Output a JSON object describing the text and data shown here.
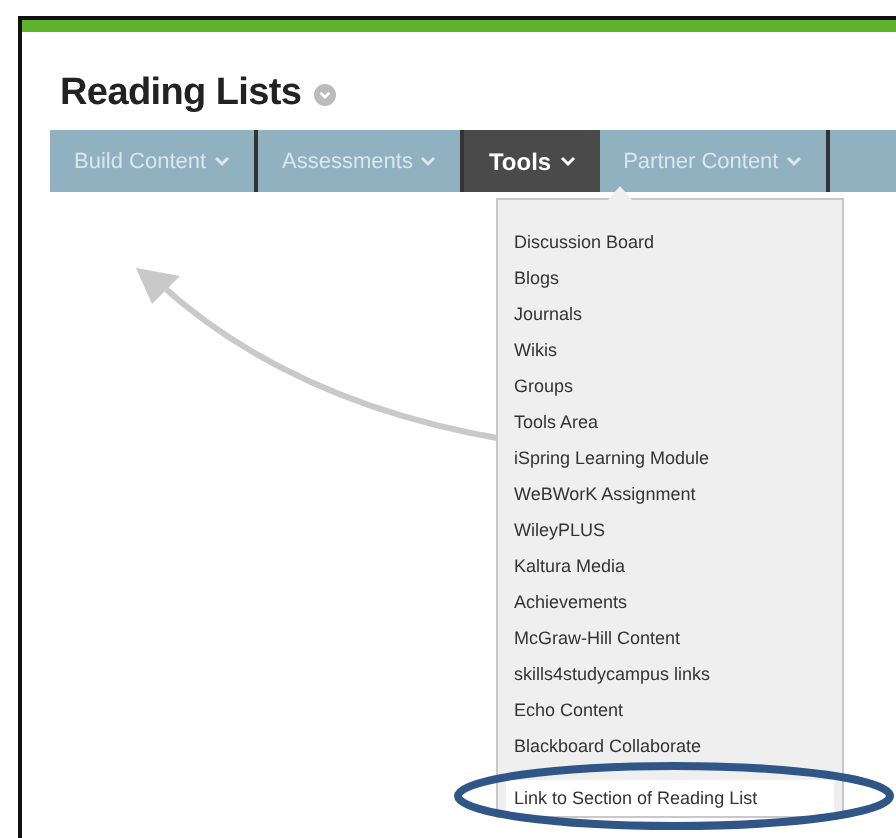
{
  "page": {
    "title": "Reading Lists"
  },
  "tabs": [
    {
      "label": "Build Content",
      "selected": false
    },
    {
      "label": "Assessments",
      "selected": false
    },
    {
      "label": "Tools",
      "selected": true
    },
    {
      "label": "Partner Content",
      "selected": false
    }
  ],
  "dropdown": {
    "items": [
      {
        "label": "Discussion Board",
        "selected": false
      },
      {
        "label": "Blogs",
        "selected": false
      },
      {
        "label": "Journals",
        "selected": false
      },
      {
        "label": "Wikis",
        "selected": false
      },
      {
        "label": "Groups",
        "selected": false
      },
      {
        "label": "Tools Area",
        "selected": false
      },
      {
        "label": "iSpring Learning Module",
        "selected": false
      },
      {
        "label": "WeBWorK Assignment",
        "selected": false
      },
      {
        "label": "WileyPLUS",
        "selected": false
      },
      {
        "label": "Kaltura Media",
        "selected": false
      },
      {
        "label": "Achievements",
        "selected": false
      },
      {
        "label": "McGraw-Hill Content",
        "selected": false
      },
      {
        "label": "skills4studycampus links",
        "selected": false
      },
      {
        "label": "Echo Content",
        "selected": false
      },
      {
        "label": "Blackboard Collaborate",
        "selected": false
      },
      {
        "label": "Link to Section of Reading List",
        "selected": true
      }
    ]
  }
}
